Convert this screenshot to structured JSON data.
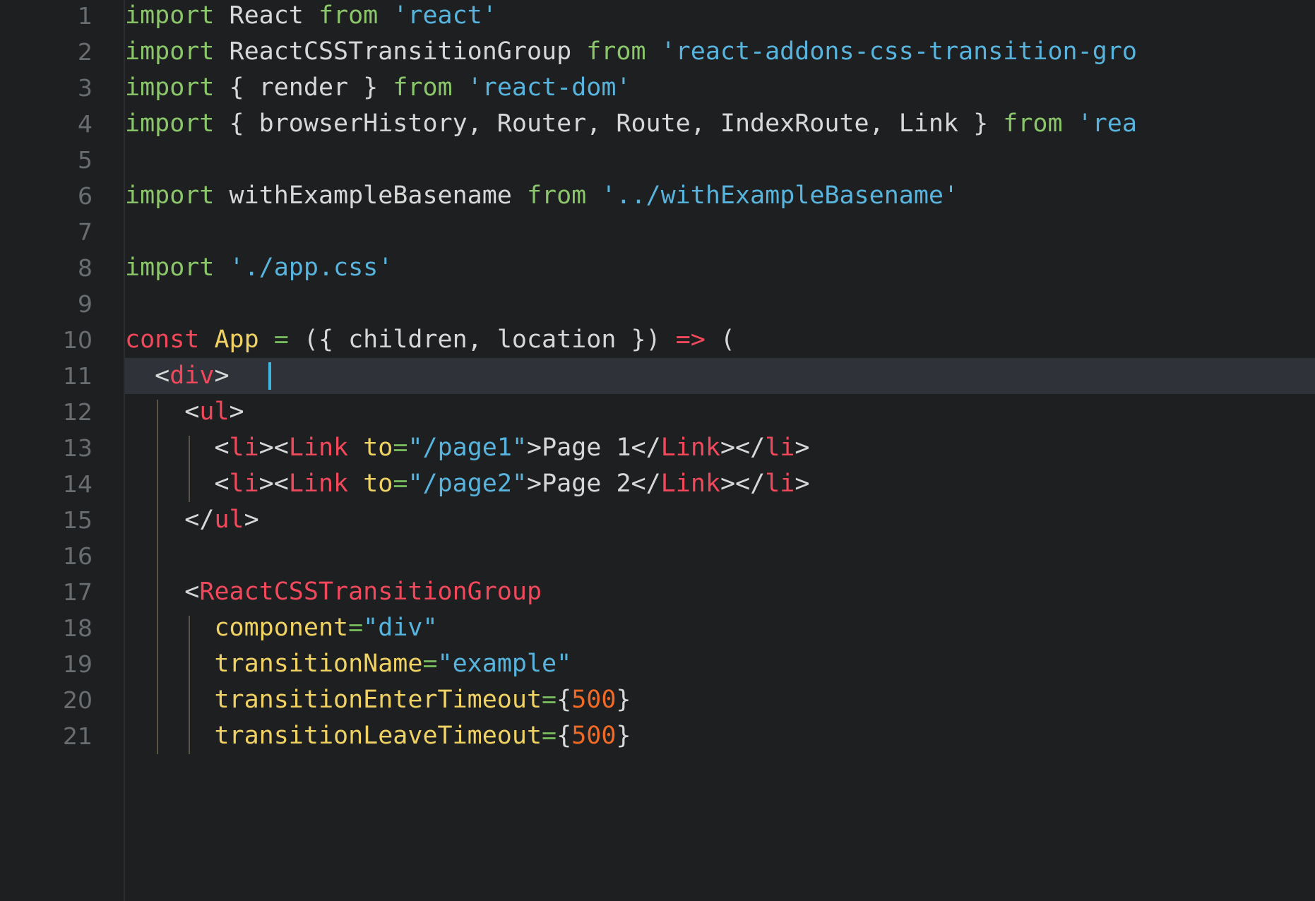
{
  "editor": {
    "name": "code-editor",
    "language": "javascript-jsx",
    "background_color": "#1d1f21",
    "active_line_color": "#2f3238",
    "cursor_color": "#3fb6e0",
    "gutter_color": "#6a6d70",
    "active_line_number": 11,
    "cursor_line": 11,
    "cursor_column": 9,
    "font_size_px": 35,
    "line_height_px": 51
  },
  "colors": {
    "keyword": "#8bc66a",
    "string": "#58b4dd",
    "tag": "#f2485b",
    "attribute": "#f0d264",
    "operator": "#76b95c",
    "number": "#ef6a26",
    "plain": "#d5d8d7",
    "comment": "#6a6d70",
    "indent_guide": "#5a5444"
  },
  "line_numbers": [
    "1",
    "2",
    "3",
    "4",
    "5",
    "6",
    "7",
    "8",
    "9",
    "10",
    "11",
    "12",
    "13",
    "14",
    "15",
    "16",
    "17",
    "18",
    "19",
    "20",
    "21"
  ],
  "lines": [
    {
      "number": "1",
      "indent": 0,
      "tokens": [
        {
          "text": "import",
          "type": "keyword"
        },
        {
          "text": " React ",
          "type": "plain"
        },
        {
          "text": "from",
          "type": "keyword"
        },
        {
          "text": " ",
          "type": "plain"
        },
        {
          "text": "'react'",
          "type": "string"
        }
      ]
    },
    {
      "number": "2",
      "indent": 0,
      "tokens": [
        {
          "text": "import",
          "type": "keyword"
        },
        {
          "text": " ReactCSSTransitionGroup ",
          "type": "plain"
        },
        {
          "text": "from",
          "type": "keyword"
        },
        {
          "text": " ",
          "type": "plain"
        },
        {
          "text": "'react-addons-css-transition-gro",
          "type": "string"
        }
      ]
    },
    {
      "number": "3",
      "indent": 0,
      "tokens": [
        {
          "text": "import",
          "type": "keyword"
        },
        {
          "text": " { render } ",
          "type": "plain"
        },
        {
          "text": "from",
          "type": "keyword"
        },
        {
          "text": " ",
          "type": "plain"
        },
        {
          "text": "'react-dom'",
          "type": "string"
        }
      ]
    },
    {
      "number": "4",
      "indent": 0,
      "tokens": [
        {
          "text": "import",
          "type": "keyword"
        },
        {
          "text": " { browserHistory, Router, Route, IndexRoute, Link } ",
          "type": "plain"
        },
        {
          "text": "from",
          "type": "keyword"
        },
        {
          "text": " ",
          "type": "plain"
        },
        {
          "text": "'rea",
          "type": "string"
        }
      ]
    },
    {
      "number": "5",
      "indent": 0,
      "tokens": []
    },
    {
      "number": "6",
      "indent": 0,
      "tokens": [
        {
          "text": "import",
          "type": "keyword"
        },
        {
          "text": " withExampleBasename ",
          "type": "plain"
        },
        {
          "text": "from",
          "type": "keyword"
        },
        {
          "text": " ",
          "type": "plain"
        },
        {
          "text": "'../withExampleBasename'",
          "type": "string"
        }
      ]
    },
    {
      "number": "7",
      "indent": 0,
      "tokens": []
    },
    {
      "number": "8",
      "indent": 0,
      "tokens": [
        {
          "text": "import",
          "type": "keyword"
        },
        {
          "text": " ",
          "type": "plain"
        },
        {
          "text": "'./app.css'",
          "type": "string"
        }
      ]
    },
    {
      "number": "9",
      "indent": 0,
      "tokens": []
    },
    {
      "number": "10",
      "indent": 0,
      "tokens": [
        {
          "text": "const",
          "type": "tag"
        },
        {
          "text": " ",
          "type": "plain"
        },
        {
          "text": "App",
          "type": "attribute"
        },
        {
          "text": " ",
          "type": "plain"
        },
        {
          "text": "=",
          "type": "operator"
        },
        {
          "text": " ({ children, location }) ",
          "type": "plain"
        },
        {
          "text": "=>",
          "type": "tag"
        },
        {
          "text": " (",
          "type": "plain"
        }
      ]
    },
    {
      "number": "11",
      "indent": 1,
      "active": true,
      "tokens": [
        {
          "text": "  ",
          "type": "plain"
        },
        {
          "text": "<",
          "type": "plain"
        },
        {
          "text": "div",
          "type": "tag"
        },
        {
          "text": ">",
          "type": "plain"
        }
      ]
    },
    {
      "number": "12",
      "indent": 2,
      "tokens": [
        {
          "text": "    ",
          "type": "plain"
        },
        {
          "text": "<",
          "type": "plain"
        },
        {
          "text": "ul",
          "type": "tag"
        },
        {
          "text": ">",
          "type": "plain"
        }
      ]
    },
    {
      "number": "13",
      "indent": 3,
      "tokens": [
        {
          "text": "      ",
          "type": "plain"
        },
        {
          "text": "<",
          "type": "plain"
        },
        {
          "text": "li",
          "type": "tag"
        },
        {
          "text": ">",
          "type": "plain"
        },
        {
          "text": "<",
          "type": "plain"
        },
        {
          "text": "Link",
          "type": "tag"
        },
        {
          "text": " ",
          "type": "plain"
        },
        {
          "text": "to",
          "type": "attribute"
        },
        {
          "text": "=",
          "type": "operator"
        },
        {
          "text": "\"/page1\"",
          "type": "string"
        },
        {
          "text": ">Page 1</",
          "type": "plain"
        },
        {
          "text": "Link",
          "type": "tag"
        },
        {
          "text": "></",
          "type": "plain"
        },
        {
          "text": "li",
          "type": "tag"
        },
        {
          "text": ">",
          "type": "plain"
        }
      ]
    },
    {
      "number": "14",
      "indent": 3,
      "tokens": [
        {
          "text": "      ",
          "type": "plain"
        },
        {
          "text": "<",
          "type": "plain"
        },
        {
          "text": "li",
          "type": "tag"
        },
        {
          "text": ">",
          "type": "plain"
        },
        {
          "text": "<",
          "type": "plain"
        },
        {
          "text": "Link",
          "type": "tag"
        },
        {
          "text": " ",
          "type": "plain"
        },
        {
          "text": "to",
          "type": "attribute"
        },
        {
          "text": "=",
          "type": "operator"
        },
        {
          "text": "\"/page2\"",
          "type": "string"
        },
        {
          "text": ">Page 2</",
          "type": "plain"
        },
        {
          "text": "Link",
          "type": "tag"
        },
        {
          "text": "></",
          "type": "plain"
        },
        {
          "text": "li",
          "type": "tag"
        },
        {
          "text": ">",
          "type": "plain"
        }
      ]
    },
    {
      "number": "15",
      "indent": 2,
      "tokens": [
        {
          "text": "    ",
          "type": "plain"
        },
        {
          "text": "</",
          "type": "plain"
        },
        {
          "text": "ul",
          "type": "tag"
        },
        {
          "text": ">",
          "type": "plain"
        }
      ]
    },
    {
      "number": "16",
      "indent": 0,
      "tokens": []
    },
    {
      "number": "17",
      "indent": 2,
      "tokens": [
        {
          "text": "    ",
          "type": "plain"
        },
        {
          "text": "<",
          "type": "plain"
        },
        {
          "text": "ReactCSSTransitionGroup",
          "type": "tag"
        }
      ]
    },
    {
      "number": "18",
      "indent": 3,
      "tokens": [
        {
          "text": "      ",
          "type": "plain"
        },
        {
          "text": "component",
          "type": "attribute"
        },
        {
          "text": "=",
          "type": "operator"
        },
        {
          "text": "\"div\"",
          "type": "string"
        }
      ]
    },
    {
      "number": "19",
      "indent": 3,
      "tokens": [
        {
          "text": "      ",
          "type": "plain"
        },
        {
          "text": "transitionName",
          "type": "attribute"
        },
        {
          "text": "=",
          "type": "operator"
        },
        {
          "text": "\"example\"",
          "type": "string"
        }
      ]
    },
    {
      "number": "20",
      "indent": 3,
      "tokens": [
        {
          "text": "      ",
          "type": "plain"
        },
        {
          "text": "transitionEnterTimeout",
          "type": "attribute"
        },
        {
          "text": "=",
          "type": "operator"
        },
        {
          "text": "{",
          "type": "plain"
        },
        {
          "text": "500",
          "type": "number"
        },
        {
          "text": "}",
          "type": "plain"
        }
      ]
    },
    {
      "number": "21",
      "indent": 3,
      "tokens": [
        {
          "text": "      ",
          "type": "plain"
        },
        {
          "text": "transitionLeaveTimeout",
          "type": "attribute"
        },
        {
          "text": "=",
          "type": "operator"
        },
        {
          "text": "{",
          "type": "plain"
        },
        {
          "text": "500",
          "type": "number"
        },
        {
          "text": "}",
          "type": "plain"
        }
      ]
    }
  ],
  "indent_guides": [
    {
      "column": 2,
      "from_line": 12,
      "to_line": 21
    },
    {
      "column": 4,
      "from_line": 13,
      "to_line": 14
    },
    {
      "column": 4,
      "from_line": 18,
      "to_line": 21
    }
  ]
}
